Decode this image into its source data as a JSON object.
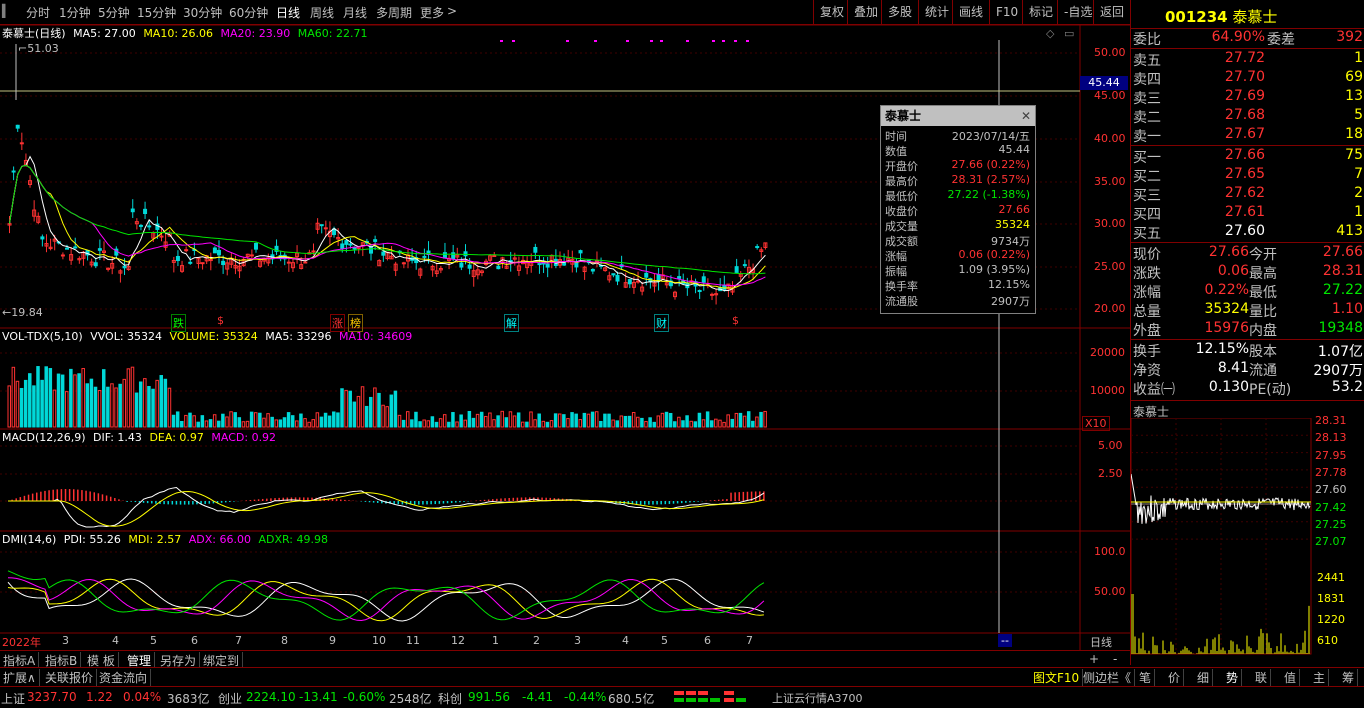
{
  "toolbar": {
    "periods": [
      "分时",
      "1分钟",
      "5分钟",
      "15分钟",
      "30分钟",
      "60分钟",
      "日线",
      "周线",
      "月线",
      "多周期",
      "更多"
    ],
    "right_buttons": [
      "复权",
      "叠加",
      "多股",
      "统计",
      "画线",
      "F10",
      "标记",
      "-自选",
      "返回"
    ]
  },
  "main_chart": {
    "title": "泰慕士(日线)",
    "ma_labels": [
      "MA5: 27.00",
      "MA10: 26.06",
      "MA20: 23.90",
      "MA60: 22.71"
    ],
    "high_label": "51.03",
    "low_label": "19.84",
    "price_axis": [
      "50.00",
      "45.00",
      "40.00",
      "35.00",
      "30.00",
      "25.00",
      "20.00"
    ],
    "cursor_price": "45.44",
    "event_markers": [
      "跌",
      "$",
      "涨",
      "榜",
      "解",
      "财",
      "$"
    ]
  },
  "volume_panel": {
    "title": "VOL-TDX(5,10)",
    "values": [
      "VVOL: 35324",
      "VOLUME: 35324",
      "MA5: 33296",
      "MA10: 34609"
    ],
    "axis": [
      "20000",
      "10000"
    ],
    "unit": "X10"
  },
  "macd_panel": {
    "title": "MACD(12,26,9)",
    "values": [
      "DIF: 1.43",
      "DEA: 0.97",
      "MACD: 0.92"
    ],
    "axis": [
      "5.00",
      "2.50"
    ]
  },
  "dmi_panel": {
    "title": "DMI(14,6)",
    "values": [
      "PDI: 55.26",
      "MDI: 2.57",
      "ADX: 66.00",
      "ADXR: 49.98"
    ],
    "axis": [
      "100.0",
      "50.00"
    ]
  },
  "date_axis": {
    "labels": [
      "2022年",
      "3",
      "4",
      "5",
      "6",
      "7",
      "8",
      "9",
      "10",
      "11",
      "12",
      "1",
      "2",
      "3",
      "4",
      "5",
      "6",
      "7"
    ],
    "period_label": "日线"
  },
  "tooltip": {
    "title": "泰慕士",
    "rows": [
      {
        "label": "时间",
        "value": "2023/07/14/五",
        "color": "#c0c0c0"
      },
      {
        "label": "数值",
        "value": "45.44",
        "color": "#c0c0c0"
      },
      {
        "label": "开盘价",
        "value": "27.66 (0.22%)",
        "color": "#ff3232"
      },
      {
        "label": "最高价",
        "value": "28.31 (2.57%)",
        "color": "#ff3232"
      },
      {
        "label": "最低价",
        "value": "27.22 (-1.38%)",
        "color": "#00e600"
      },
      {
        "label": "收盘价",
        "value": "27.66",
        "color": "#ff3232"
      },
      {
        "label": "成交量",
        "value": "35324",
        "color": "#ffff00"
      },
      {
        "label": "成交额",
        "value": "9734万",
        "color": "#c0c0c0"
      },
      {
        "label": "涨幅",
        "value": "0.06 (0.22%)",
        "color": "#ff3232"
      },
      {
        "label": "振幅",
        "value": "1.09 (3.95%)",
        "color": "#c0c0c0"
      },
      {
        "label": "换手率",
        "value": "12.15%",
        "color": "#c0c0c0"
      },
      {
        "label": "流通股",
        "value": "2907万",
        "color": "#c0c0c0"
      }
    ]
  },
  "quote": {
    "code": "001234",
    "name": "泰慕士",
    "weibi_label": "委比",
    "weibi_value": "64.90%",
    "weicha_label": "委差",
    "weicha_value": "392",
    "asks": [
      {
        "label": "卖五",
        "price": "27.72",
        "vol": "1"
      },
      {
        "label": "卖四",
        "price": "27.70",
        "vol": "69"
      },
      {
        "label": "卖三",
        "price": "27.69",
        "vol": "13"
      },
      {
        "label": "卖二",
        "price": "27.68",
        "vol": "5"
      },
      {
        "label": "卖一",
        "price": "27.67",
        "vol": "18"
      }
    ],
    "bids": [
      {
        "label": "买一",
        "price": "27.66",
        "vol": "75"
      },
      {
        "label": "买二",
        "price": "27.65",
        "vol": "7"
      },
      {
        "label": "买三",
        "price": "27.62",
        "vol": "2"
      },
      {
        "label": "买四",
        "price": "27.61",
        "vol": "1"
      },
      {
        "label": "买五",
        "price": "27.60",
        "vol": "413"
      }
    ],
    "stats": [
      {
        "l1": "现价",
        "v1": "27.66",
        "c1": "#ff3232",
        "l2": "今开",
        "v2": "27.66",
        "c2": "#ff3232"
      },
      {
        "l1": "涨跌",
        "v1": "0.06",
        "c1": "#ff3232",
        "l2": "最高",
        "v2": "28.31",
        "c2": "#ff3232"
      },
      {
        "l1": "涨幅",
        "v1": "0.22%",
        "c1": "#ff3232",
        "l2": "最低",
        "v2": "27.22",
        "c2": "#00e600"
      },
      {
        "l1": "总量",
        "v1": "35324",
        "c1": "#ffff00",
        "l2": "量比",
        "v2": "1.10",
        "c2": "#ff3232"
      },
      {
        "l1": "外盘",
        "v1": "15976",
        "c1": "#ff3232",
        "l2": "内盘",
        "v2": "19348",
        "c2": "#00e600"
      }
    ],
    "stats2": [
      {
        "l1": "换手",
        "v1": "12.15%",
        "l2": "股本",
        "v2": "1.07亿"
      },
      {
        "l1": "净资",
        "v1": "8.41",
        "l2": "流通",
        "v2": "2907万"
      },
      {
        "l1": "收益㈠",
        "v1": "0.130",
        "l2": "PE(动)",
        "v2": "53.2"
      }
    ]
  },
  "mini_chart": {
    "title": "泰慕士",
    "price_axis": [
      "28.31",
      "28.13",
      "27.95",
      "27.78",
      "27.60",
      "27.42",
      "27.25",
      "27.07"
    ],
    "vol_axis": [
      "2441",
      "1831",
      "1220",
      "610"
    ]
  },
  "right_tabs": [
    "笔",
    "价",
    "细",
    "势",
    "联",
    "值",
    "主",
    "筹"
  ],
  "bottom_tabs": [
    "指标A",
    "指标B",
    "模 板",
    "管理",
    "另存为",
    "绑定到"
  ],
  "bottom_tabs2": [
    "扩展∧",
    "关联报价",
    "资金流向"
  ],
  "side_tools": [
    "图文F10",
    "侧边栏《"
  ],
  "zoom_buttons": [
    "+",
    "-"
  ],
  "status": {
    "sh_label": "上证",
    "sh_value": "3237.70",
    "sh_change": "1.22",
    "sh_pct": "0.04%",
    "sh_amount": "3683亿",
    "cy_label": "创业",
    "cy_value": "2224.10",
    "cy_change": "-13.41",
    "cy_pct": "-0.60%",
    "cy_amount": "2548亿",
    "kc_label": "科创",
    "kc_value": "991.56",
    "kc_change": "-4.41",
    "kc_pct": "-0.44%",
    "kc_amount": "680.5亿",
    "cloud": "上证云行情A3700"
  }
}
